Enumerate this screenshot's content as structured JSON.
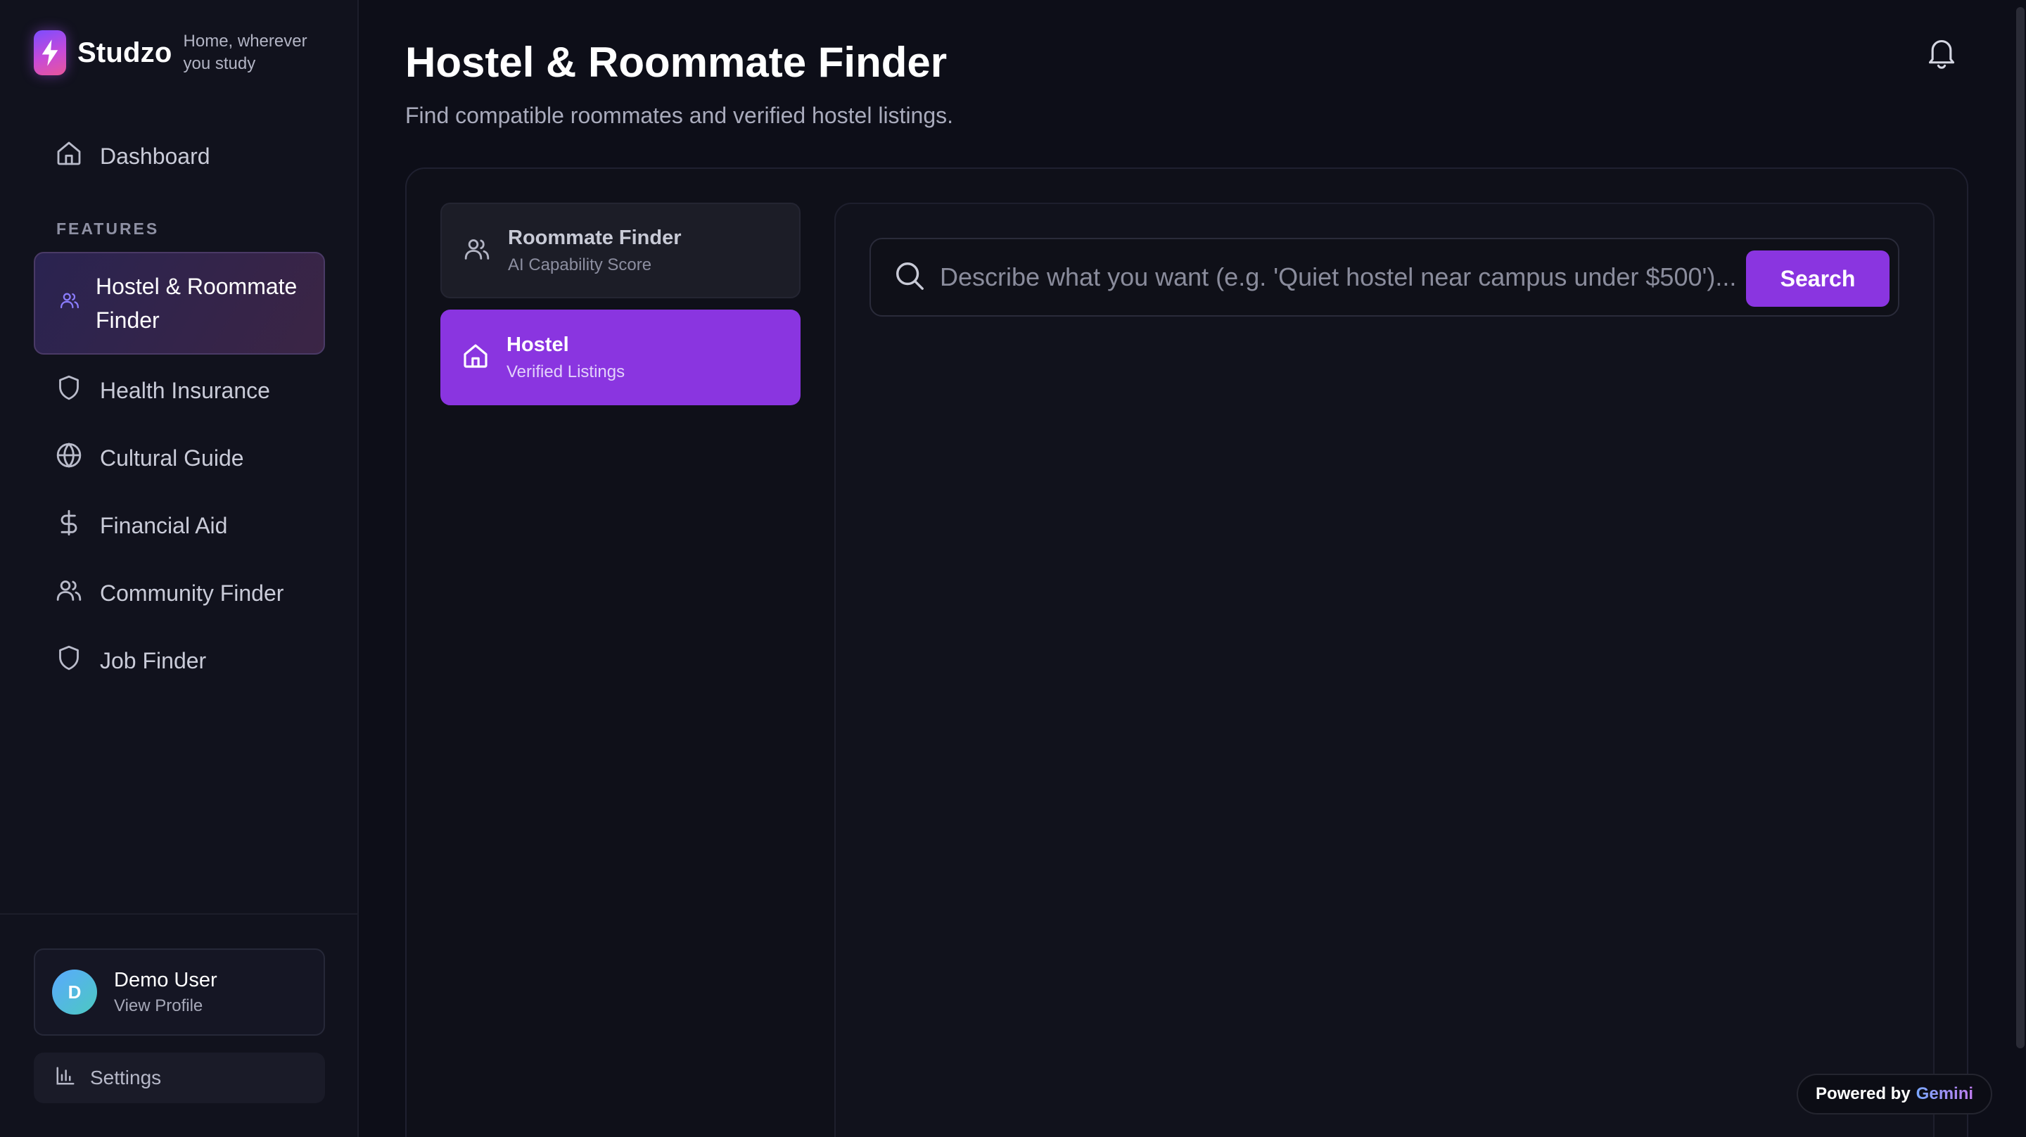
{
  "brand": {
    "name": "Studzo",
    "tagline": "Home, wherever you study"
  },
  "sidebar": {
    "dashboard": {
      "label": "Dashboard",
      "icon": "home-icon"
    },
    "section_label": "FEATURES",
    "items": [
      {
        "label": "Hostel & Roommate Finder",
        "icon": "users-icon",
        "active": true
      },
      {
        "label": "Health Insurance",
        "icon": "shield-icon"
      },
      {
        "label": "Cultural Guide",
        "icon": "globe-icon"
      },
      {
        "label": "Financial Aid",
        "icon": "dollar-icon"
      },
      {
        "label": "Community Finder",
        "icon": "users-icon"
      },
      {
        "label": "Job Finder",
        "icon": "shield-icon"
      }
    ],
    "profile": {
      "initial": "D",
      "name": "Demo User",
      "subtitle": "View Profile"
    },
    "settings_label": "Settings"
  },
  "header": {
    "title": "Hostel & Roommate Finder",
    "subtitle": "Find compatible roommates and verified hostel listings."
  },
  "tabs": [
    {
      "title": "Roommate Finder",
      "subtitle": "AI Capability Score",
      "icon": "users-icon",
      "selected": false
    },
    {
      "title": "Hostel",
      "subtitle": "Verified Listings",
      "icon": "home-icon",
      "selected": true
    }
  ],
  "search": {
    "placeholder": "Describe what you want (e.g. 'Quiet hostel near campus under $500')...",
    "value": "",
    "button_label": "Search"
  },
  "footer_badge": {
    "prefix": "Powered by",
    "brand": "Gemini"
  },
  "colors": {
    "accent": "#8a35e0",
    "background": "#0d0e18",
    "sidebar": "#11121d",
    "active_nav_from": "#2a2350",
    "active_nav_to": "#3b2545"
  }
}
